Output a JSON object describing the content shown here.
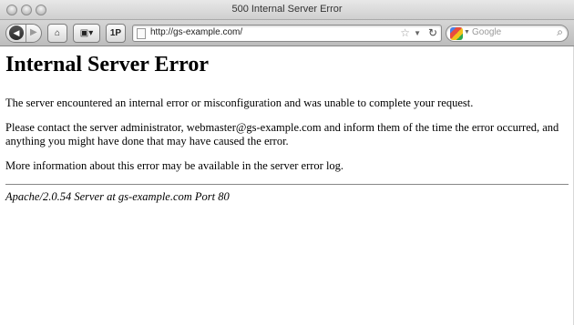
{
  "window": {
    "title": "500 Internal Server Error"
  },
  "toolbar": {
    "back_icon": "◀",
    "forward_icon": "▶",
    "home_icon": "⌂",
    "bookmarks_icon": "▣▾",
    "p_label": "1P",
    "url": "http://gs-example.com/",
    "star_icon": "☆",
    "caret_icon": "▼",
    "reload_icon": "↻",
    "search_placeholder": "Google",
    "search_icon": "⌕"
  },
  "page": {
    "heading": "Internal Server Error",
    "para1": "The server encountered an internal error or misconfiguration and was unable to complete your request.",
    "para2": "Please contact the server administrator, webmaster@gs-example.com and inform them of the time the error occurred, and anything you might have done that may have caused the error.",
    "para3": "More information about this error may be available in the server error log.",
    "server_signature": "Apache/2.0.54 Server at gs-example.com Port 80"
  }
}
